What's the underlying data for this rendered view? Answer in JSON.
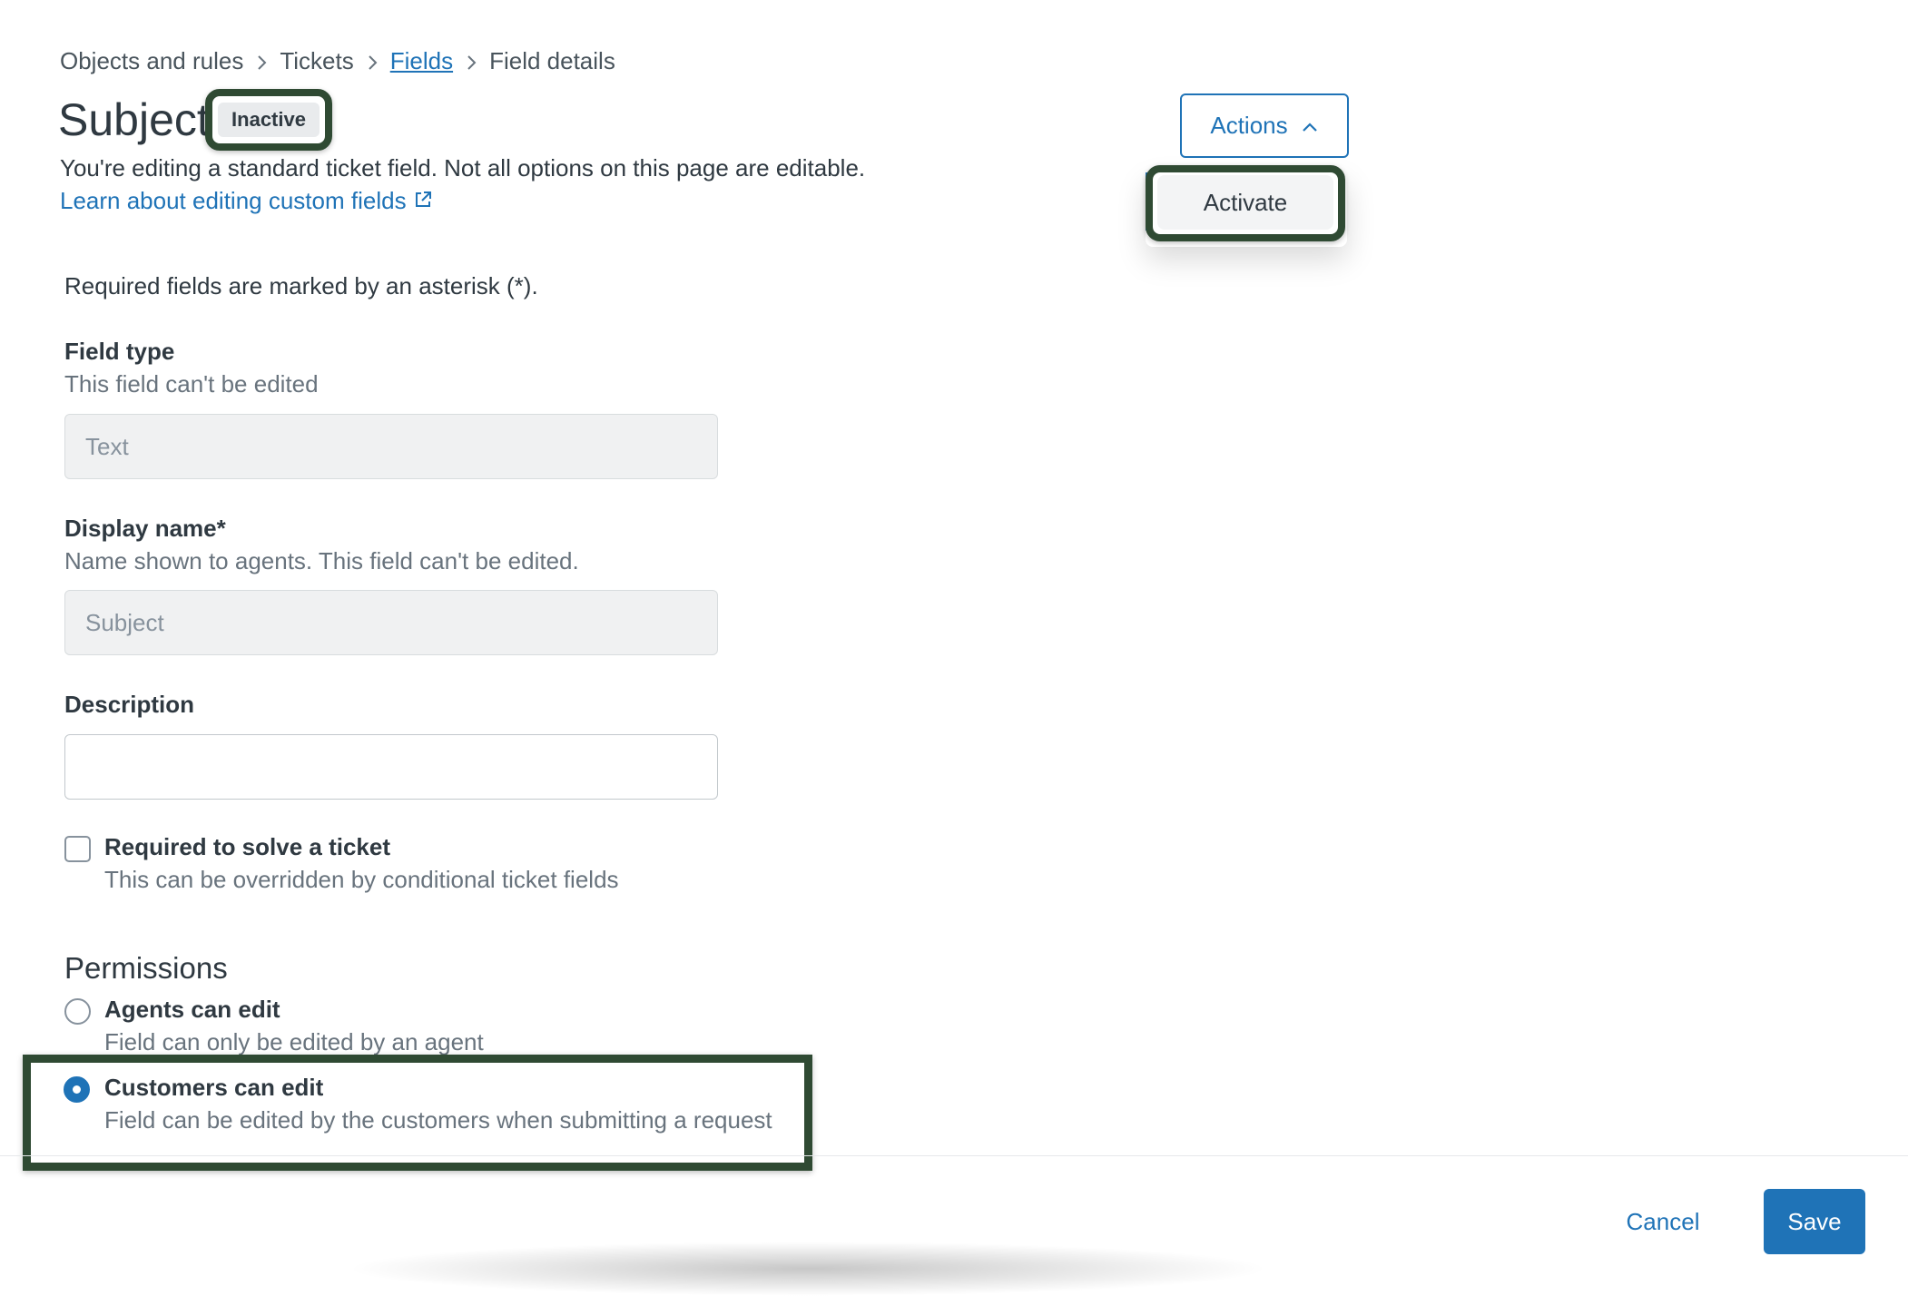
{
  "breadcrumb": {
    "items": [
      "Objects and rules",
      "Tickets",
      "Fields",
      "Field details"
    ]
  },
  "header": {
    "title": "Subject",
    "status_badge": "Inactive",
    "intro": "You're editing a standard ticket field. Not all options on this page are editable.",
    "learn_link": "Learn about editing custom fields"
  },
  "actions": {
    "button_label": "Actions",
    "menu_items": [
      "Activate"
    ]
  },
  "form": {
    "required_note": "Required fields are marked by an asterisk (*).",
    "field_type": {
      "label": "Field type",
      "hint": "This field can't be edited",
      "value": "Text"
    },
    "display_name": {
      "label": "Display name*",
      "hint": "Name shown to agents. This field can't be edited.",
      "value": "Subject"
    },
    "description": {
      "label": "Description",
      "value": ""
    },
    "required_to_solve": {
      "label": "Required to solve a ticket",
      "hint": "This can be overridden by conditional ticket fields",
      "checked": false
    }
  },
  "permissions": {
    "title": "Permissions",
    "options": [
      {
        "label": "Agents can edit",
        "hint": "Field can only be edited by an agent",
        "selected": false
      },
      {
        "label": "Customers can edit",
        "hint": "Field can be edited by the customers when submitting a request",
        "selected": true
      }
    ]
  },
  "footer": {
    "cancel_label": "Cancel",
    "save_label": "Save"
  },
  "colors": {
    "accent": "#1f73b7",
    "highlight": "#2f4a33",
    "text": "#2f3941",
    "muted": "#68737d"
  }
}
